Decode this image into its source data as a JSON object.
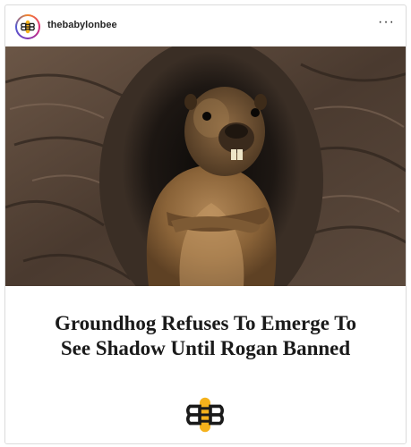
{
  "post": {
    "username": "thebabylonbee",
    "more_label": "···",
    "image_alt": "Groundhog with arms crossed in front of a burrow",
    "headline_line1": "Groundhog Refuses To Emerge To",
    "headline_line2": "See Shadow Until Rogan Banned"
  },
  "icons": {
    "avatar": "babylon-bee-logo-icon",
    "more": "more-options-icon",
    "footer": "babylon-bee-logo-icon"
  },
  "colors": {
    "bee_yellow": "#f5b21c",
    "bee_black": "#1a1a1a"
  }
}
